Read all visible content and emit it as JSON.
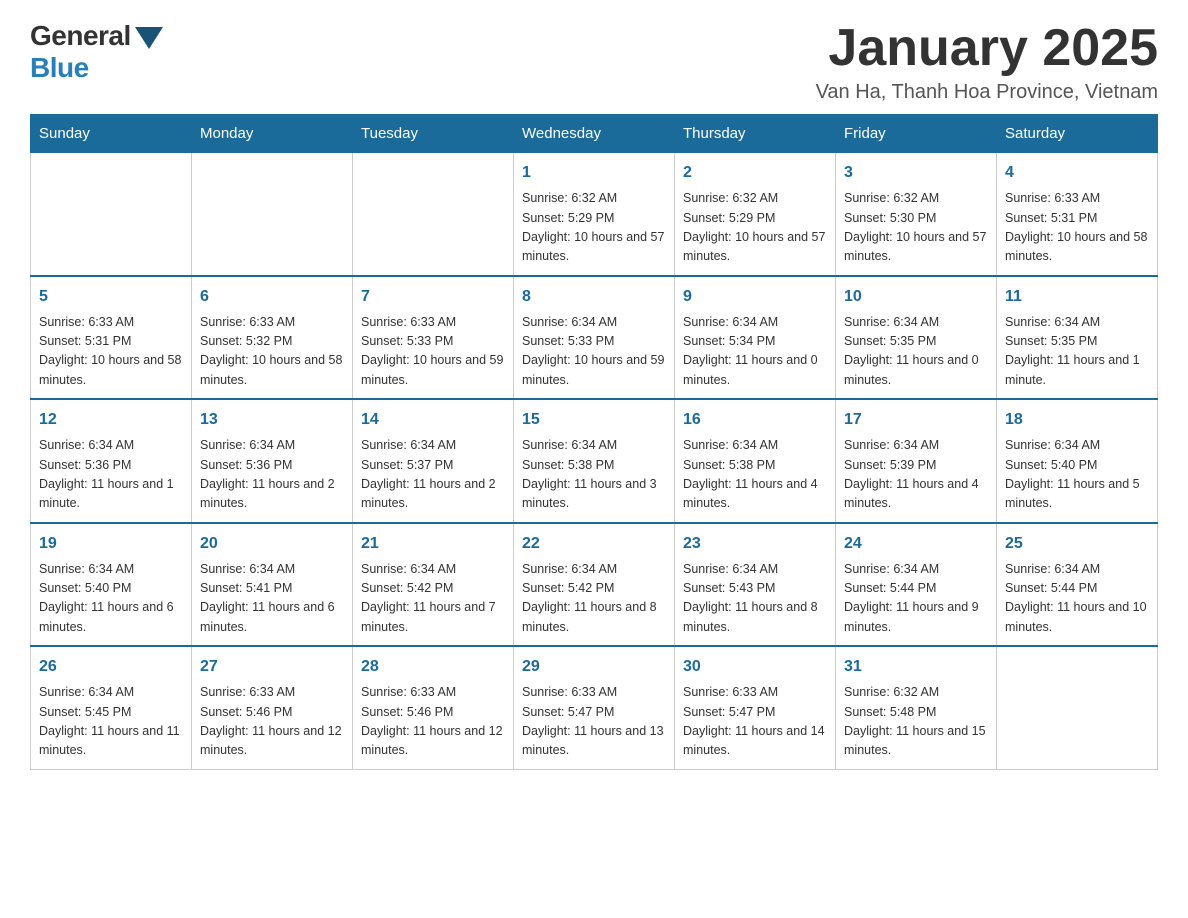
{
  "header": {
    "logo_general": "General",
    "logo_blue": "Blue",
    "month_title": "January 2025",
    "location": "Van Ha, Thanh Hoa Province, Vietnam"
  },
  "days_of_week": [
    "Sunday",
    "Monday",
    "Tuesday",
    "Wednesday",
    "Thursday",
    "Friday",
    "Saturday"
  ],
  "weeks": [
    [
      {
        "day": "",
        "info": ""
      },
      {
        "day": "",
        "info": ""
      },
      {
        "day": "",
        "info": ""
      },
      {
        "day": "1",
        "info": "Sunrise: 6:32 AM\nSunset: 5:29 PM\nDaylight: 10 hours and 57 minutes."
      },
      {
        "day": "2",
        "info": "Sunrise: 6:32 AM\nSunset: 5:29 PM\nDaylight: 10 hours and 57 minutes."
      },
      {
        "day": "3",
        "info": "Sunrise: 6:32 AM\nSunset: 5:30 PM\nDaylight: 10 hours and 57 minutes."
      },
      {
        "day": "4",
        "info": "Sunrise: 6:33 AM\nSunset: 5:31 PM\nDaylight: 10 hours and 58 minutes."
      }
    ],
    [
      {
        "day": "5",
        "info": "Sunrise: 6:33 AM\nSunset: 5:31 PM\nDaylight: 10 hours and 58 minutes."
      },
      {
        "day": "6",
        "info": "Sunrise: 6:33 AM\nSunset: 5:32 PM\nDaylight: 10 hours and 58 minutes."
      },
      {
        "day": "7",
        "info": "Sunrise: 6:33 AM\nSunset: 5:33 PM\nDaylight: 10 hours and 59 minutes."
      },
      {
        "day": "8",
        "info": "Sunrise: 6:34 AM\nSunset: 5:33 PM\nDaylight: 10 hours and 59 minutes."
      },
      {
        "day": "9",
        "info": "Sunrise: 6:34 AM\nSunset: 5:34 PM\nDaylight: 11 hours and 0 minutes."
      },
      {
        "day": "10",
        "info": "Sunrise: 6:34 AM\nSunset: 5:35 PM\nDaylight: 11 hours and 0 minutes."
      },
      {
        "day": "11",
        "info": "Sunrise: 6:34 AM\nSunset: 5:35 PM\nDaylight: 11 hours and 1 minute."
      }
    ],
    [
      {
        "day": "12",
        "info": "Sunrise: 6:34 AM\nSunset: 5:36 PM\nDaylight: 11 hours and 1 minute."
      },
      {
        "day": "13",
        "info": "Sunrise: 6:34 AM\nSunset: 5:36 PM\nDaylight: 11 hours and 2 minutes."
      },
      {
        "day": "14",
        "info": "Sunrise: 6:34 AM\nSunset: 5:37 PM\nDaylight: 11 hours and 2 minutes."
      },
      {
        "day": "15",
        "info": "Sunrise: 6:34 AM\nSunset: 5:38 PM\nDaylight: 11 hours and 3 minutes."
      },
      {
        "day": "16",
        "info": "Sunrise: 6:34 AM\nSunset: 5:38 PM\nDaylight: 11 hours and 4 minutes."
      },
      {
        "day": "17",
        "info": "Sunrise: 6:34 AM\nSunset: 5:39 PM\nDaylight: 11 hours and 4 minutes."
      },
      {
        "day": "18",
        "info": "Sunrise: 6:34 AM\nSunset: 5:40 PM\nDaylight: 11 hours and 5 minutes."
      }
    ],
    [
      {
        "day": "19",
        "info": "Sunrise: 6:34 AM\nSunset: 5:40 PM\nDaylight: 11 hours and 6 minutes."
      },
      {
        "day": "20",
        "info": "Sunrise: 6:34 AM\nSunset: 5:41 PM\nDaylight: 11 hours and 6 minutes."
      },
      {
        "day": "21",
        "info": "Sunrise: 6:34 AM\nSunset: 5:42 PM\nDaylight: 11 hours and 7 minutes."
      },
      {
        "day": "22",
        "info": "Sunrise: 6:34 AM\nSunset: 5:42 PM\nDaylight: 11 hours and 8 minutes."
      },
      {
        "day": "23",
        "info": "Sunrise: 6:34 AM\nSunset: 5:43 PM\nDaylight: 11 hours and 8 minutes."
      },
      {
        "day": "24",
        "info": "Sunrise: 6:34 AM\nSunset: 5:44 PM\nDaylight: 11 hours and 9 minutes."
      },
      {
        "day": "25",
        "info": "Sunrise: 6:34 AM\nSunset: 5:44 PM\nDaylight: 11 hours and 10 minutes."
      }
    ],
    [
      {
        "day": "26",
        "info": "Sunrise: 6:34 AM\nSunset: 5:45 PM\nDaylight: 11 hours and 11 minutes."
      },
      {
        "day": "27",
        "info": "Sunrise: 6:33 AM\nSunset: 5:46 PM\nDaylight: 11 hours and 12 minutes."
      },
      {
        "day": "28",
        "info": "Sunrise: 6:33 AM\nSunset: 5:46 PM\nDaylight: 11 hours and 12 minutes."
      },
      {
        "day": "29",
        "info": "Sunrise: 6:33 AM\nSunset: 5:47 PM\nDaylight: 11 hours and 13 minutes."
      },
      {
        "day": "30",
        "info": "Sunrise: 6:33 AM\nSunset: 5:47 PM\nDaylight: 11 hours and 14 minutes."
      },
      {
        "day": "31",
        "info": "Sunrise: 6:32 AM\nSunset: 5:48 PM\nDaylight: 11 hours and 15 minutes."
      },
      {
        "day": "",
        "info": ""
      }
    ]
  ]
}
